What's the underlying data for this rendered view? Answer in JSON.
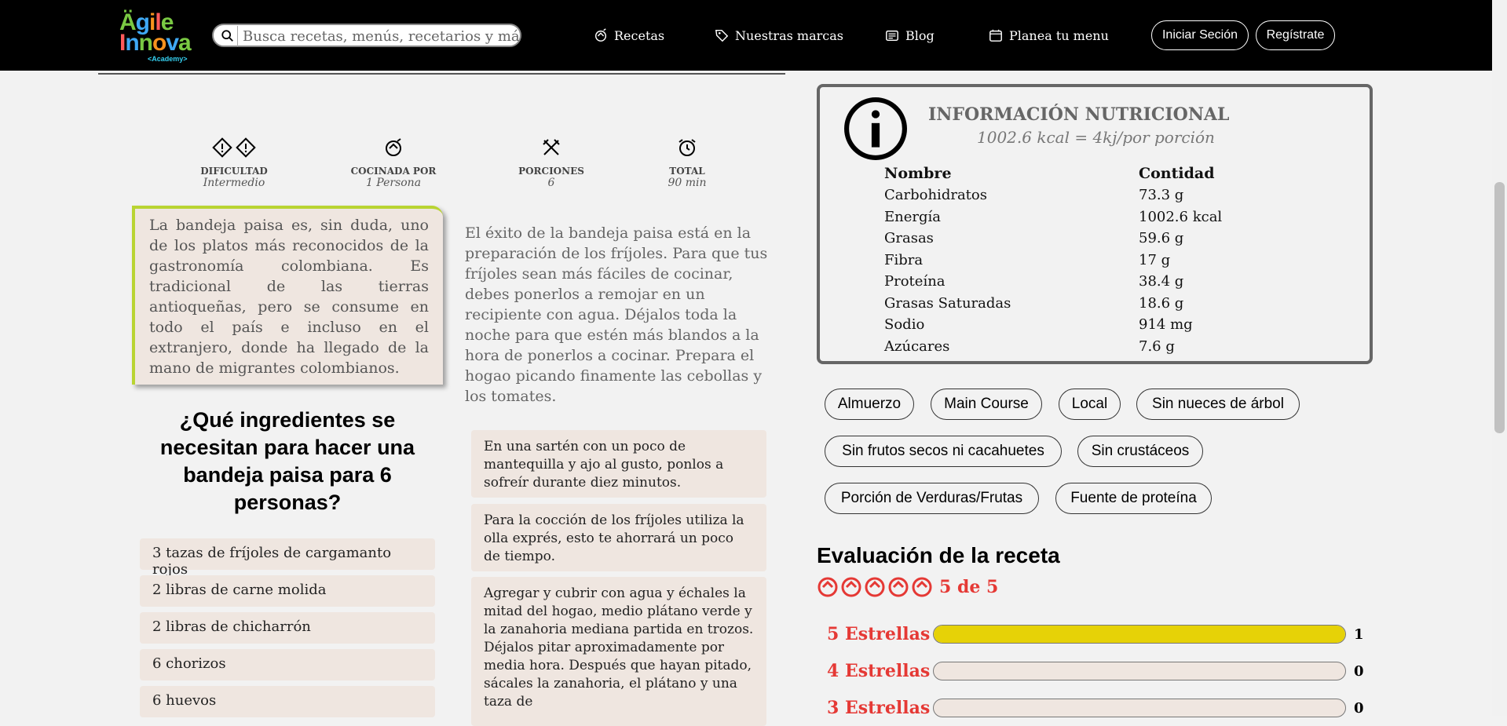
{
  "nav": {
    "logo_line1": "Ägile",
    "logo_line2": "Innova",
    "logo_sub": "<Academy>",
    "search_placeholder": "Busca recetas, menús, recetarios y más",
    "links": [
      "Recetas",
      "Nuestras marcas",
      "Blog",
      "Planea tu menu"
    ],
    "login": "Iniciar Seción",
    "register": "Regístrate"
  },
  "meta": [
    {
      "label": "DIFICULTAD",
      "value": "Intermedio"
    },
    {
      "label": "COCINADA POR",
      "value": "1 Persona"
    },
    {
      "label": "PORCIONES",
      "value": "6"
    },
    {
      "label": "TOTAL",
      "value": "90 min"
    }
  ],
  "intro": {
    "card_text": "La bandeja paisa es, sin duda, uno de los platos más reconocidos de la gastronomía colombiana. Es tradicional de las tierras antioqueñas, pero se consume en todo el país e incluso en el extranjero, donde ha llegado de la mano de migrantes colombianos.",
    "side_text": "El éxito de la bandeja paisa está en la preparación de los fríjoles. Para que tus fríjoles sean más fáciles de cocinar, debes ponerlos a remojar en un recipiente con agua. Déjalos toda la noche para que estén más blandos a la hora de ponerlos a cocinar. Prepara el hogao picando finamente las cebollas y los tomates."
  },
  "ingredients": {
    "title": "¿Qué ingredientes se necesitan para hacer una bandeja paisa para 6 personas?",
    "items": [
      "3 tazas de fríjoles de cargamanto rojos",
      "2 libras de carne molida",
      "2 libras de chicharrón",
      "6 chorizos",
      "6 huevos"
    ]
  },
  "steps": [
    "En una sartén con un poco de mantequilla y ajo al gusto, ponlos a sofreír durante diez minutos.",
    "Para la cocción de los fríjoles utiliza la olla exprés, esto te ahorrará un poco de tiempo.",
    "Agregar y cubrir con agua y échales la mitad del hogao, medio plátano verde y la zanahoria mediana partida en trozos. Déjalos pitar aproximadamente por media hora. Después que hayan pitado, sácales la zanahoria, el plátano y una taza de"
  ],
  "nutrition": {
    "title": "INFORMACIÓN NUTRICIONAL",
    "subtitle": "1002.6 kcal = 4kj/por porción",
    "col_name": "Nombre",
    "col_qty": "Contidad",
    "rows": [
      {
        "name": "Carbohidratos",
        "qty": "73.3 g"
      },
      {
        "name": "Energía",
        "qty": "1002.6 kcal"
      },
      {
        "name": "Grasas",
        "qty": "59.6 g"
      },
      {
        "name": "Fibra",
        "qty": "17 g"
      },
      {
        "name": "Proteína",
        "qty": "38.4 g"
      },
      {
        "name": "Grasas Saturadas",
        "qty": "18.6 g"
      },
      {
        "name": "Sodio",
        "qty": "914 mg"
      },
      {
        "name": "Azúcares",
        "qty": "7.6 g"
      }
    ]
  },
  "tags": [
    "Almuerzo",
    "Main Course",
    "Local",
    "Sin nueces de árbol",
    "Sin frutos secos ni cacahuetes",
    "Sin crustáceos",
    "Porción de Verduras/Frutas",
    "Fuente de proteína"
  ],
  "rating": {
    "title": "Evaluación de la receta",
    "score": "5 de 5",
    "star_color": "#e53935",
    "bar_color": "#e6d207",
    "rows": [
      {
        "label": "5 Estrellas",
        "count": "1",
        "fraction": 1
      },
      {
        "label": "4 Estrellas",
        "count": "0",
        "fraction": 0
      },
      {
        "label": "3 Estrellas",
        "count": "0",
        "fraction": 0
      }
    ]
  }
}
